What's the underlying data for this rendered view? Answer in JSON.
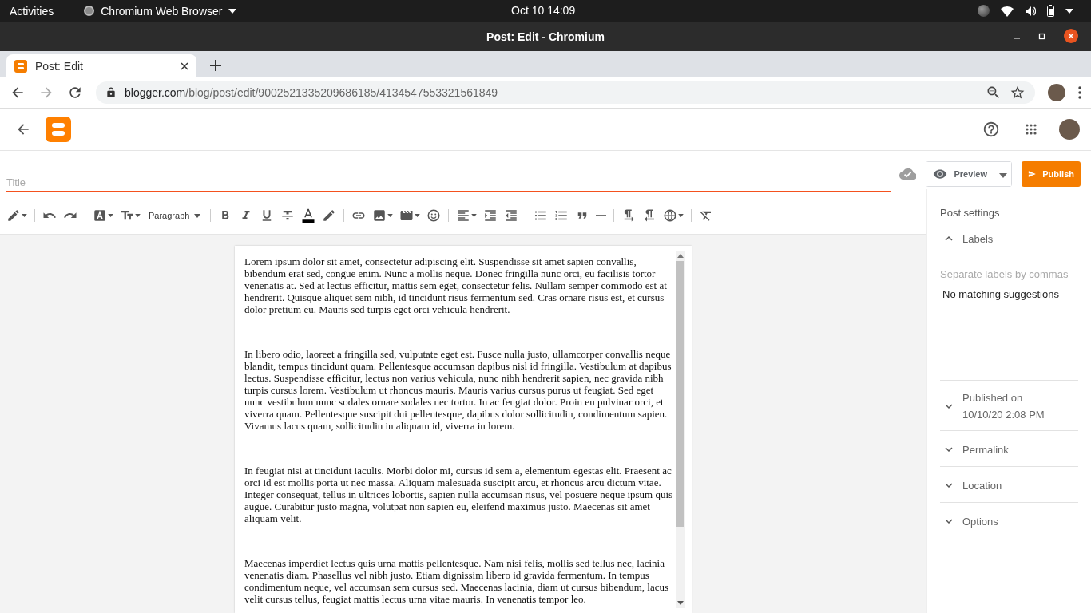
{
  "system_bar": {
    "activities": "Activities",
    "app_menu": "Chromium Web Browser",
    "clock": "Oct 10  14:09"
  },
  "window": {
    "title": "Post: Edit - Chromium"
  },
  "tabs": [
    {
      "label": "Post: Edit",
      "selected": true
    }
  ],
  "address_bar": {
    "domain": "blogger.com",
    "path": "/blog/post/edit/9002521335209686185/4134547553321561849"
  },
  "editor": {
    "title": {
      "placeholder": "Title"
    },
    "preview": "Preview",
    "publish": "Publish",
    "block_format": "Paragraph",
    "paragraphs": [
      "Lorem ipsum dolor sit amet, consectetur adipiscing elit. Suspendisse sit amet sapien convallis, bibendum erat sed, congue enim. Nunc a mollis neque. Donec fringilla nunc orci, eu facilisis tortor venenatis at. Sed at lectus efficitur, mattis sem eget, consectetur felis. Nullam semper commodo est at hendrerit. Quisque aliquet sem nibh, id tincidunt risus fermentum sed. Cras ornare risus est, et cursus dolor pretium eu. Mauris sed turpis eget orci vehicula hendrerit.",
      "In libero odio, laoreet a fringilla sed, vulputate eget est. Fusce nulla justo, ullamcorper convallis neque blandit, tempus tincidunt quam. Pellentesque accumsan dapibus nisl id fringilla. Vestibulum at dapibus lectus. Suspendisse efficitur, lectus non varius vehicula, nunc nibh hendrerit sapien, nec gravida nibh turpis cursus lorem. Vestibulum ut rhoncus mauris. Mauris varius cursus purus ut feugiat. Sed eget nunc vestibulum nunc sodales ornare sodales nec tortor. In ac feugiat dolor. Proin eu pulvinar orci, et viverra quam. Pellentesque suscipit dui pellentesque, dapibus dolor sollicitudin, condimentum sapien. Vivamus lacus quam, sollicitudin in aliquam id, viverra in lorem.",
      "In feugiat nisi at tincidunt iaculis. Morbi dolor mi, cursus id sem a, elementum egestas elit. Praesent ac orci id est mollis porta ut nec massa. Aliquam malesuada suscipit arcu, et rhoncus arcu dictum vitae. Integer consequat, tellus in ultrices lobortis, sapien nulla accumsan risus, vel posuere neque ipsum quis augue. Curabitur justo magna, volutpat non sapien eu, eleifend maximus justo. Maecenas sit amet aliquam velit.",
      "Maecenas imperdiet lectus quis urna mattis pellentesque. Nam nisi felis, mollis sed tellus nec, lacinia venenatis diam. Phasellus vel nibh justo. Etiam dignissim libero id gravida fermentum. In tempus condimentum neque, vel accumsan sem cursus sed. Maecenas lacinia, diam ut cursus bibendum, lacus velit cursus tellus, feugiat mattis lectus urna vitae mauris. In venenatis tempor leo."
    ]
  },
  "post_settings": {
    "heading": "Post settings",
    "sections": [
      {
        "label": "Labels",
        "expanded": true,
        "input": {
          "placeholder": "Separate labels by commas"
        },
        "suggestion": "No matching suggestions"
      },
      {
        "label": "Published on",
        "detail": "10/10/20 2:08 PM",
        "expanded": false
      },
      {
        "label": "Permalink",
        "expanded": false
      },
      {
        "label": "Location",
        "expanded": false
      },
      {
        "label": "Options",
        "expanded": false
      }
    ]
  }
}
